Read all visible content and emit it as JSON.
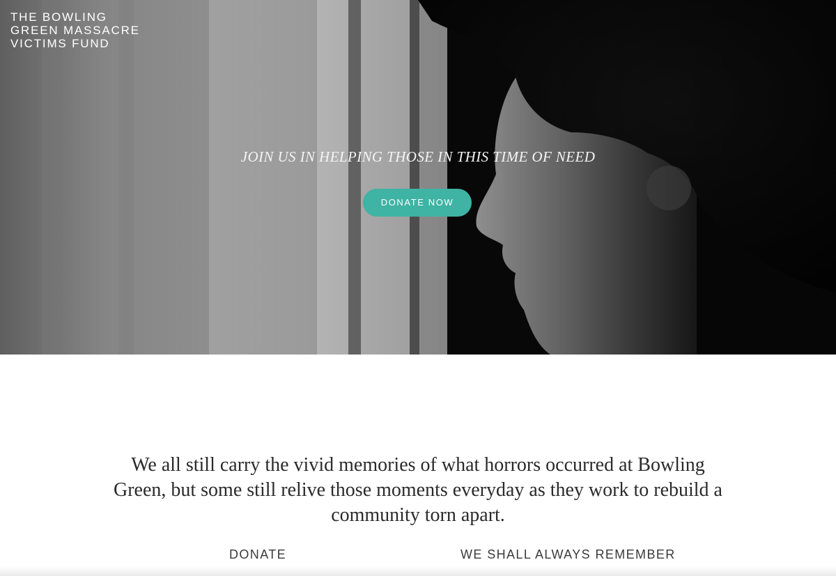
{
  "header": {
    "brand_line1": "THE BOWLING",
    "brand_line2": "GREEN MASSACRE",
    "brand_line3": "VICTIMS FUND"
  },
  "hero": {
    "tagline": "JOIN US IN HELPING THOSE IN THIS TIME OF NEED",
    "cta_label": "DONATE NOW",
    "cta_color": "#3fb3a4",
    "image_description_icon": "portrait-photo"
  },
  "main": {
    "statement": "We all still carry the vivid memories of what horrors occurred at Bowling Green, but some still relive those moments everyday as they work to rebuild a community torn apart."
  },
  "nav": {
    "links": [
      {
        "label": "DONATE"
      },
      {
        "label": "WE SHALL ALWAYS REMEMBER"
      }
    ]
  }
}
